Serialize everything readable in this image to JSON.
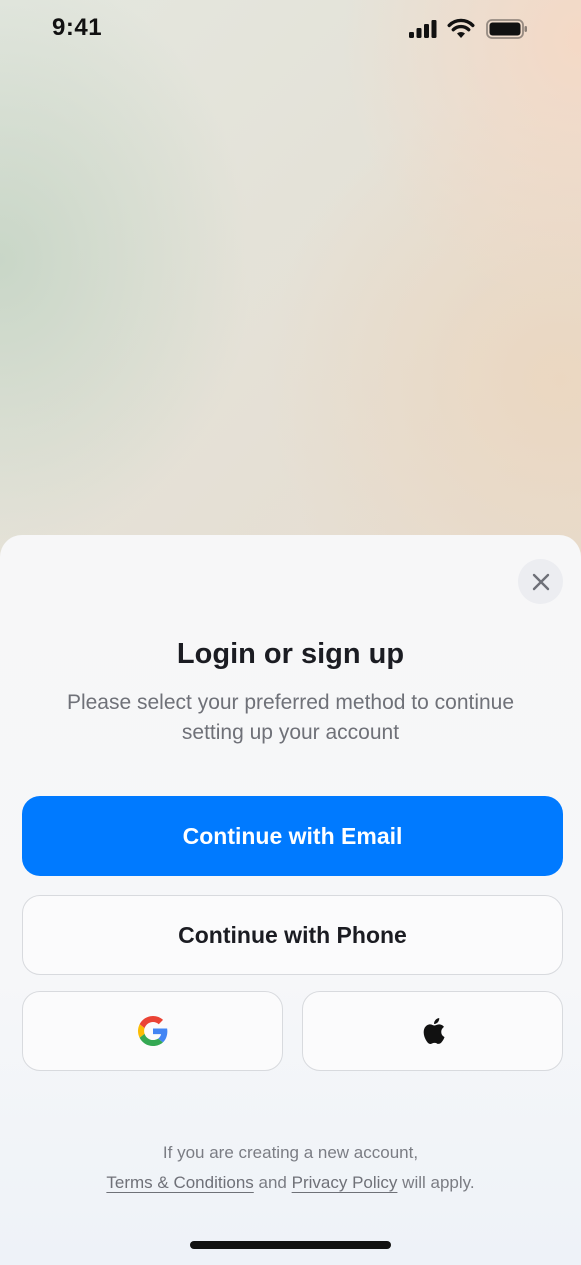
{
  "status_bar": {
    "time": "9:41",
    "icons": [
      "cellular-signal-icon",
      "wifi-icon",
      "battery-icon"
    ]
  },
  "sheet": {
    "close_icon": "close-icon",
    "title": "Login or sign up",
    "subtitle": "Please select your preferred method to continue setting up your account",
    "email_button": "Continue with Email",
    "phone_button": "Continue with Phone",
    "google_icon": "google-icon",
    "apple_icon": "apple-icon",
    "legal": {
      "line1": "If you are creating a new account,",
      "terms_link": "Terms & Conditions",
      "and_text": "and",
      "privacy_link": "Privacy Policy",
      "suffix": "will apply."
    }
  },
  "colors": {
    "primary": "#007aff",
    "title_text": "#1b1c22",
    "muted_text": "#6f7178"
  }
}
